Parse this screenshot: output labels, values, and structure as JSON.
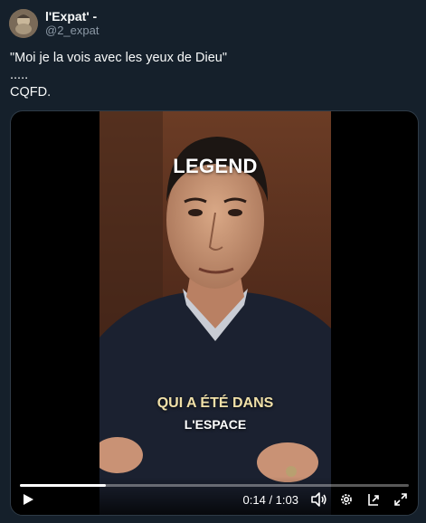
{
  "author": {
    "display_name": "l'Expat' -",
    "handle": "@2_expat"
  },
  "tweet": {
    "lines": [
      "\"Moi je la vois avec les yeux de Dieu\"",
      ".....",
      "CQFD."
    ]
  },
  "video": {
    "overlay_title": "LEGEND",
    "caption_line1": "QUI A ÉTÉ DANS",
    "caption_line2": "L'ESPACE",
    "time_display": "0:14 / 1:03",
    "progress": 0.22
  },
  "colors": {
    "background": "#15202b",
    "secondary_text": "#8b98a5",
    "caption_accent": "#f0e0a8"
  },
  "icons": [
    "play-icon",
    "volume-icon",
    "settings-icon",
    "popout-icon",
    "fullscreen-icon"
  ]
}
